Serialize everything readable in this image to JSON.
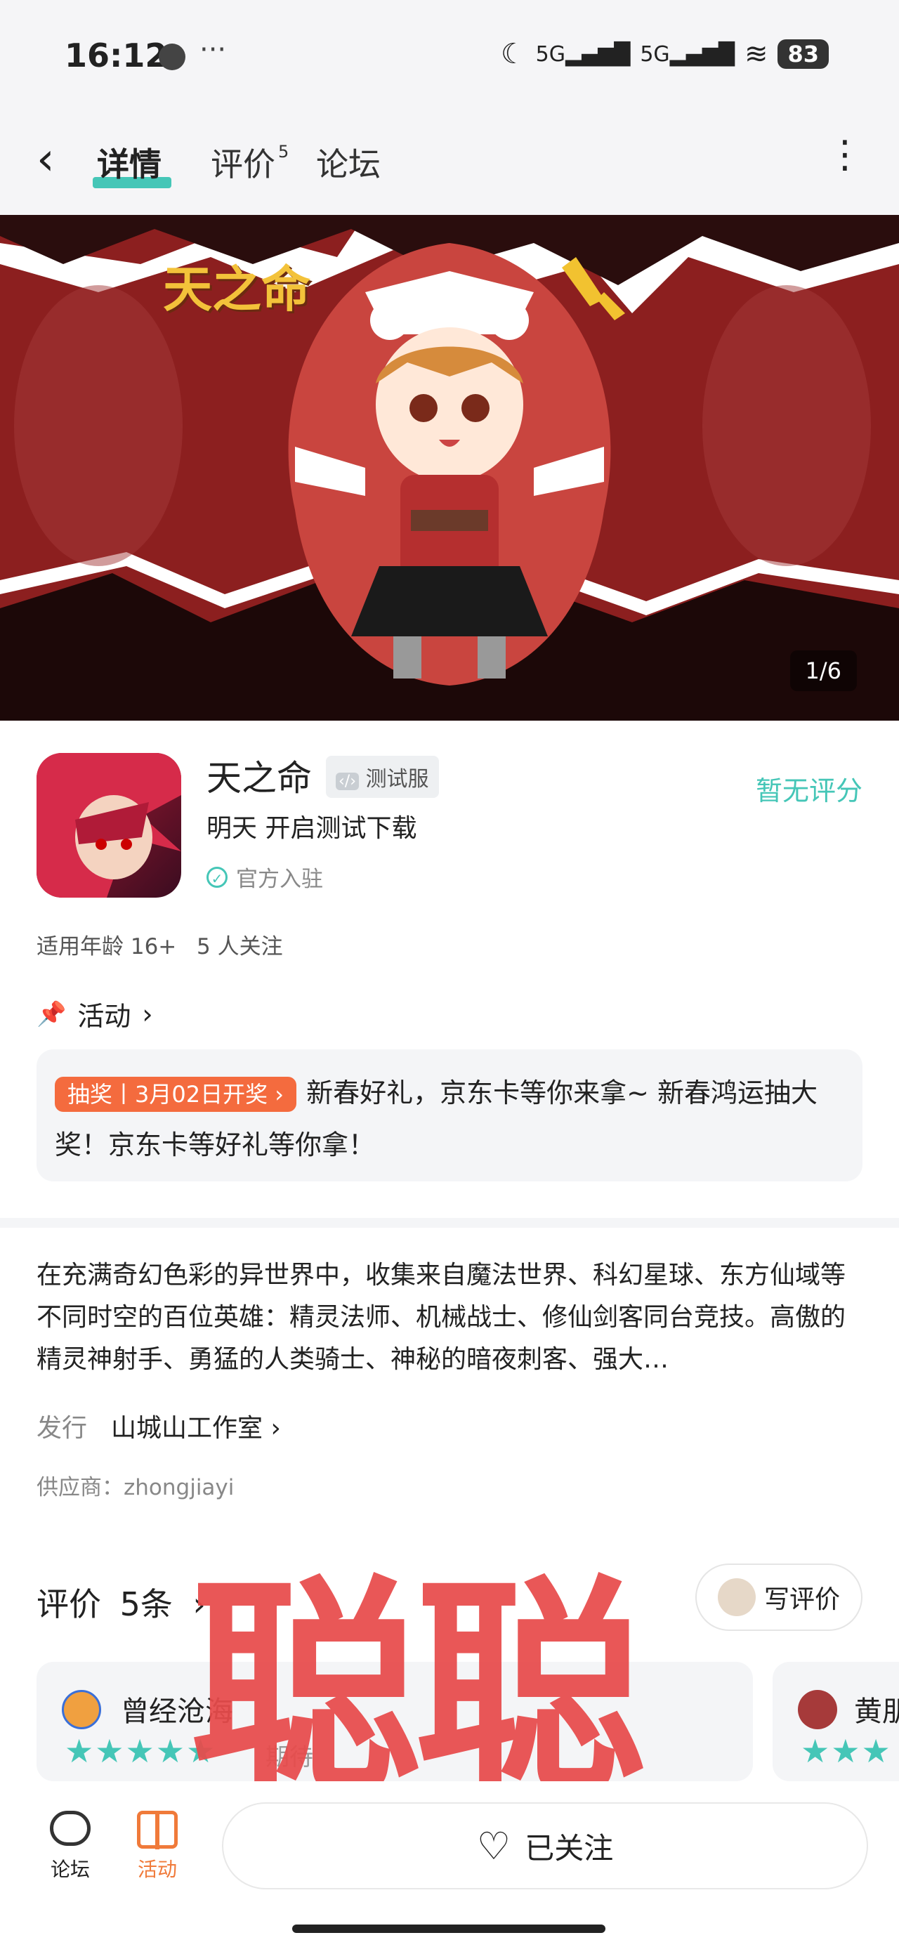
{
  "status_bar": {
    "time": "16:12",
    "network1": "5G",
    "network2": "5G",
    "battery": "83"
  },
  "nav": {
    "tabs": [
      {
        "label": "详情"
      },
      {
        "label": "评价",
        "badge": "5"
      },
      {
        "label": "论坛"
      }
    ]
  },
  "banner": {
    "counter": "1/6",
    "logo_text": "天之命"
  },
  "app": {
    "name": "天之命",
    "tag": "测试服",
    "subtitle": "明天 开启测试下载",
    "official": "官方入驻",
    "score": "暂无评分",
    "age": "适用年龄 16+",
    "followers": "5 人关注"
  },
  "activity": {
    "header": "活动",
    "tag": "抽奖丨3月02日开奖",
    "text": "新春好礼，京东卡等你来拿~ 新春鸿运抽大奖！京东卡等好礼等你拿！"
  },
  "description": "在充满奇幻色彩的异世界中，收集来自魔法世界、科幻星球、东方仙域等不同时空的百位英雄：精灵法师、机械战士、修仙剑客同台竞技。高傲的精灵神射手、勇猛的人类骑士、神秘的暗夜刺客、强大…",
  "publisher": {
    "label": "发行",
    "value": "山城山工作室"
  },
  "supplier": "供应商：zhongjiayi",
  "reviews": {
    "title": "评价",
    "count": "5条",
    "write": "写评价",
    "items": [
      {
        "name": "曾经沧海",
        "stars": "★★★★★",
        "note": "期待"
      },
      {
        "name": "黄朋",
        "stars": "★★★"
      }
    ]
  },
  "watermark": "聪聪",
  "bottom": {
    "forum": "论坛",
    "activity": "活动",
    "follow": "已关注"
  },
  "colors": {
    "accent": "#45c6b7",
    "activity_tag": "#f46b3e",
    "watermark": "#e84b4b"
  }
}
